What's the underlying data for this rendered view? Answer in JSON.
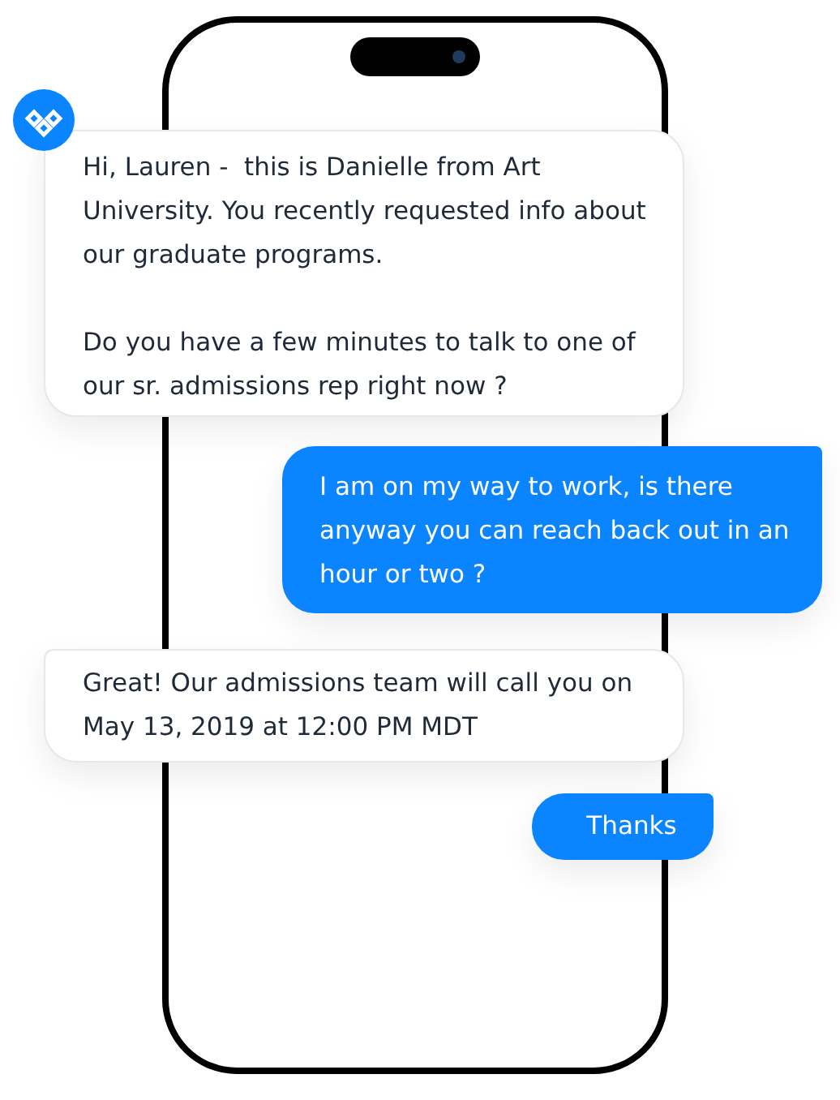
{
  "messages": [
    {
      "kind": "incoming",
      "text": "Hi, Lauren -  this is Danielle from Art University. You recently requested info about our graduate programs.\n\nDo you have a few minutes to talk to one of our sr. admissions rep right now ?"
    },
    {
      "kind": "outgoing",
      "text": "I am on my way to work, is there anyway you can reach back out in an hour or two ?"
    },
    {
      "kind": "incoming",
      "text": "Great! Our admissions team will call you on May 13, 2019 at 12:00 PM MDT"
    },
    {
      "kind": "outgoing",
      "text": "Thanks"
    }
  ]
}
